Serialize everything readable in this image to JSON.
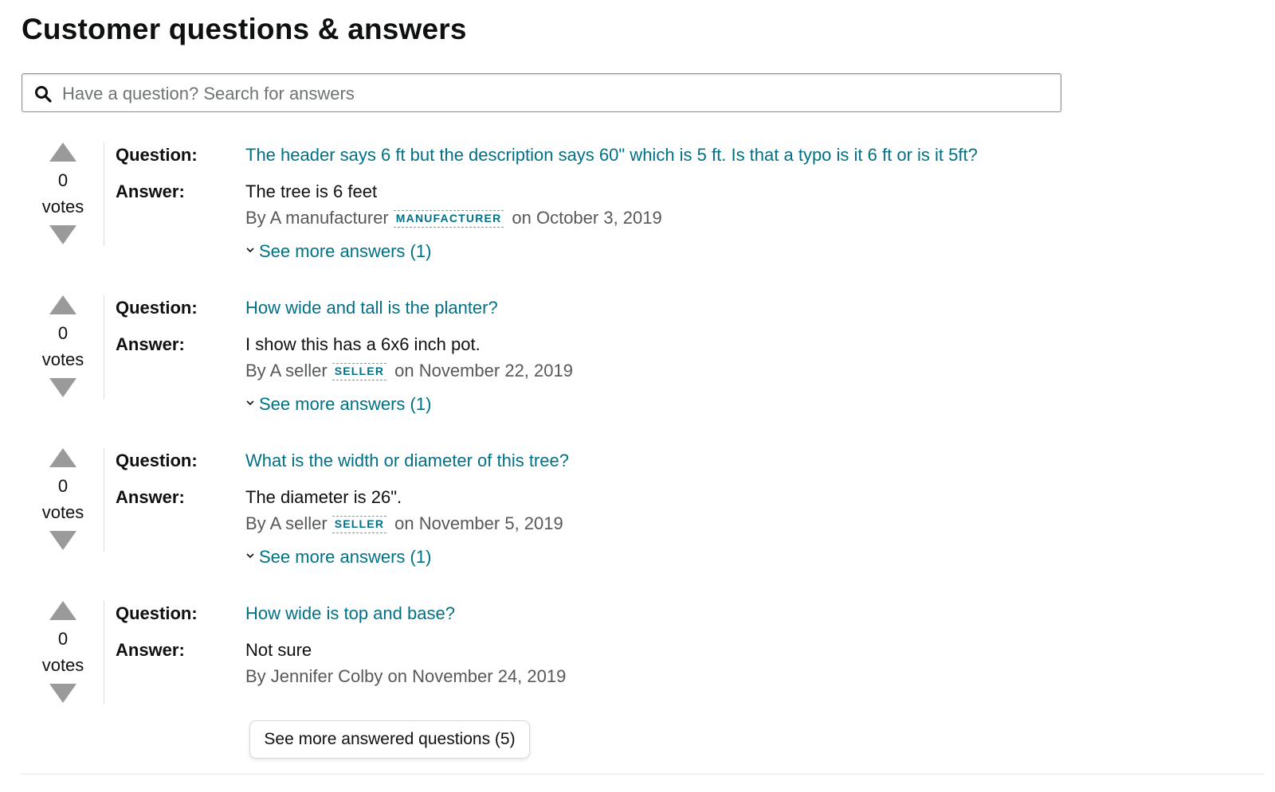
{
  "header": {
    "title": "Customer questions & answers"
  },
  "search": {
    "placeholder": "Have a question? Search for answers",
    "value": ""
  },
  "labels": {
    "question": "Question:",
    "answer": "Answer:"
  },
  "qa": [
    {
      "votes": "0",
      "votes_label": "votes",
      "question": "The header says 6 ft but the description says 60\" which is 5 ft. Is that a typo is it 6 ft or is it 5ft?",
      "answer": "The tree is 6 feet",
      "by_prefix": "By A manufacturer",
      "badge": "MANUFACTURER",
      "date": "on October 3, 2019",
      "more_answers": "See more answers (1)"
    },
    {
      "votes": "0",
      "votes_label": "votes",
      "question": "How wide and tall is the planter?",
      "answer": "I show this has a 6x6 inch pot.",
      "by_prefix": "By A seller",
      "badge": "SELLER",
      "date": "on November 22, 2019",
      "more_answers": "See more answers (1)"
    },
    {
      "votes": "0",
      "votes_label": "votes",
      "question": "What is the width or diameter of this tree?",
      "answer": "The diameter is 26\".",
      "by_prefix": "By A seller",
      "badge": "SELLER",
      "date": "on November 5, 2019",
      "more_answers": "See more answers (1)"
    },
    {
      "votes": "0",
      "votes_label": "votes",
      "question": "How wide is top and base?",
      "answer": "Not sure",
      "byline": "By Jennifer Colby on November 24, 2019"
    }
  ],
  "footer": {
    "more_questions_label": "See more answered questions (5)"
  },
  "colors": {
    "link": "#007185",
    "text": "#0f1111",
    "muted": "#565959",
    "arrow": "#9a9a9a"
  },
  "icons": {
    "search": "search-icon",
    "upvote": "upvote-arrow-icon",
    "downvote": "downvote-arrow-icon",
    "expand": "chevron-down-icon"
  }
}
